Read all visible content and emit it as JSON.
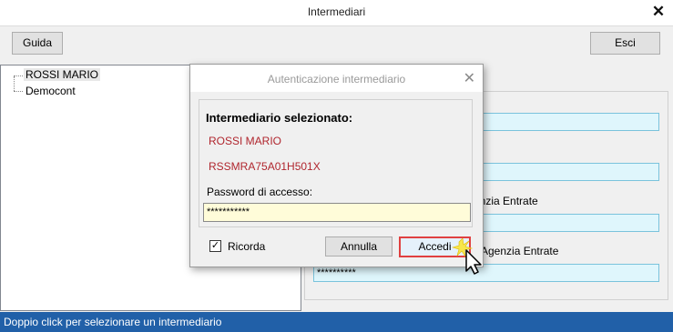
{
  "window": {
    "title": "Intermediari",
    "close_glyph": "✕"
  },
  "toolbar": {
    "guida_label": "Guida",
    "esci_label": "Esci"
  },
  "tree": {
    "items": [
      {
        "label": "ROSSI MARIO"
      },
      {
        "label": "Democont"
      }
    ]
  },
  "right_panel": {
    "label_agenzia_1": "enzia Entrate",
    "label_agenzia_2": "Agenzia Entrate",
    "field_4_value": "**********"
  },
  "status_bar": {
    "text": "Doppio click per selezionare un intermediario"
  },
  "dialog": {
    "title": "Autenticazione intermediario",
    "close_glyph": "✕",
    "selected_heading": "Intermediario selezionato:",
    "selected_name": "ROSSI MARIO",
    "selected_code": "RSSMRA75A01H501X",
    "password_label": "Password di accesso:",
    "password_value": "***********",
    "remember_label": "Ricorda",
    "remember_checked_glyph": "✓",
    "annulla_label": "Annulla",
    "accedi_label": "Accedi"
  },
  "colors": {
    "status_bar": "#2160a8",
    "highlight_field": "#dff6fc",
    "password_field": "#fffcd9",
    "selected_text": "#b0262e",
    "focus_border": "#e04040"
  },
  "icons": {
    "cursor": "click-cursor-icon"
  }
}
